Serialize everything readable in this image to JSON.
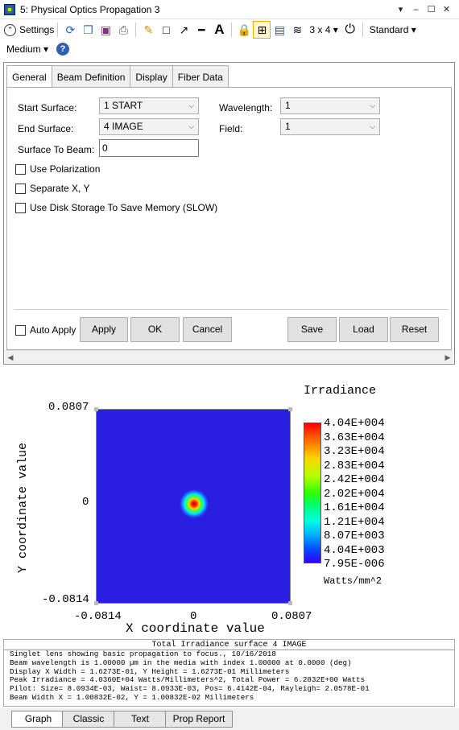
{
  "window": {
    "title": "5: Physical Optics Propagation 3",
    "buttons": [
      "▾",
      "–",
      "☐",
      "✕"
    ]
  },
  "toolbar": {
    "settings_label": "Settings",
    "layout_label": "3 x 4 ▾",
    "standard_label": "Standard ▾",
    "medium_label": "Medium ▾"
  },
  "tabs": [
    "General",
    "Beam Definition",
    "Display",
    "Fiber Data"
  ],
  "general": {
    "start_surface_label": "Start Surface:",
    "start_surface_value": "1 START",
    "end_surface_label": "End Surface:",
    "end_surface_value": "4 IMAGE",
    "surface_to_beam_label": "Surface To Beam:",
    "surface_to_beam_value": "0",
    "wavelength_label": "Wavelength:",
    "wavelength_value": "1",
    "field_label": "Field:",
    "field_value": "1",
    "use_polarization": "Use Polarization",
    "separate_xy": "Separate X, Y",
    "disk_storage": "Use Disk Storage To Save Memory (SLOW)"
  },
  "actions": {
    "auto_apply": "Auto Apply",
    "apply": "Apply",
    "ok": "OK",
    "cancel": "Cancel",
    "save": "Save",
    "load": "Load",
    "reset": "Reset"
  },
  "plot": {
    "title": "Irradiance",
    "x_label": "X coordinate value",
    "y_label": "Y coordinate value",
    "x_ticks": [
      "-0.0814",
      "0",
      "0.0807"
    ],
    "y_ticks": [
      "0.0807",
      "0",
      "-0.0814"
    ],
    "colorbar_ticks": [
      "4.04E+004",
      "3.63E+004",
      "3.23E+004",
      "2.83E+004",
      "2.42E+004",
      "2.02E+004",
      "1.61E+004",
      "1.21E+004",
      "8.07E+003",
      "4.04E+003",
      "7.95E-006"
    ],
    "units": "Watts/mm^2"
  },
  "report": {
    "title": "Total Irradiance surface 4 IMAGE",
    "lines": [
      "Singlet lens showing basic propagation to focus., 10/16/2018",
      "Beam wavelength is 1.00000 µm in the media with index 1.00000 at 0.0000 (deg)",
      "Display X Width = 1.6273E-01, Y Height = 1.6273E-01 Millimeters",
      "Peak Irradiance = 4.0360E+04 Watts/Millimeters^2, Total Power = 6.2832E+00 Watts",
      "Pilot: Size= 8.0934E-03, Waist= 8.0933E-03, Pos= 6.4142E-04, Rayleigh= 2.0578E-01",
      "Beam Width X = 1.00832E-02, Y = 1.00832E-02 Millimeters"
    ]
  },
  "bottom_tabs": [
    "Graph",
    "Classic",
    "Text",
    "Prop Report"
  ]
}
